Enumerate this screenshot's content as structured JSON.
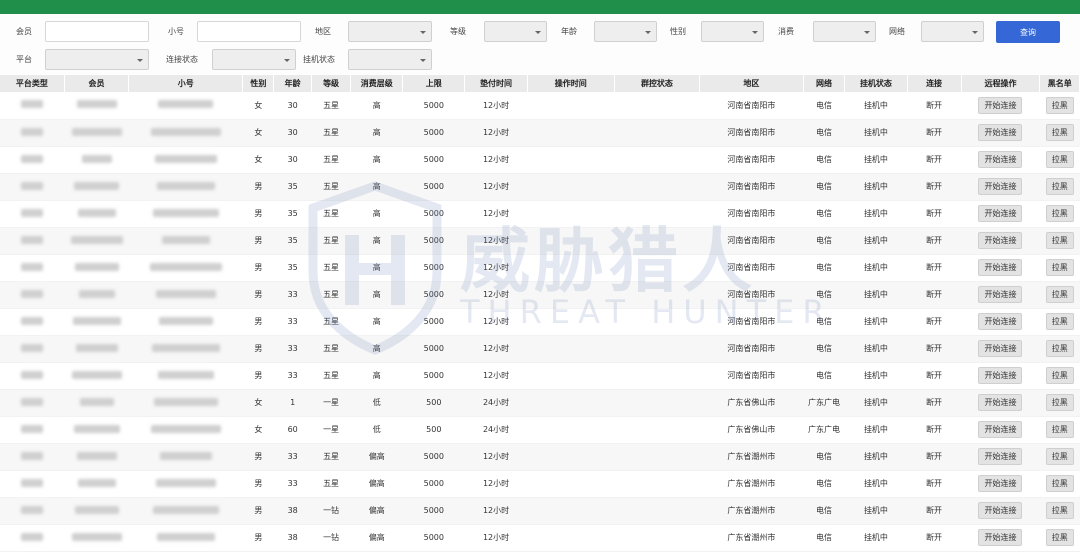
{
  "filters": {
    "member_label": "会员",
    "member_value": "",
    "alt_label": "小号",
    "alt_value": "",
    "region_label": "地区",
    "level_label": "等级",
    "age_label": "年龄",
    "gender_label": "性别",
    "spending_label": "消费",
    "network_label": "网络",
    "platform_label": "平台",
    "connect_status_label": "连接状态",
    "hang_status_label": "挂机状态",
    "search_button": "查询"
  },
  "table": {
    "columns": [
      "平台类型",
      "会员",
      "小号",
      "性别",
      "年龄",
      "等级",
      "消费层级",
      "上限",
      "垫付时间",
      "操作时间",
      "群控状态",
      "地区",
      "网络",
      "挂机状态",
      "连接",
      "远程操作",
      "黑名单"
    ],
    "rows": [
      {
        "gender": "女",
        "age": "30",
        "level": "五星",
        "spend": "高",
        "limit": "5000",
        "pay_time": "12小时",
        "region": "河南省南阳市",
        "network": "电信",
        "hang": "挂机中",
        "conn": "断开",
        "remote": "开始连接",
        "black": "拉黑"
      },
      {
        "gender": "女",
        "age": "30",
        "level": "五星",
        "spend": "高",
        "limit": "5000",
        "pay_time": "12小时",
        "region": "河南省南阳市",
        "network": "电信",
        "hang": "挂机中",
        "conn": "断开",
        "remote": "开始连接",
        "black": "拉黑"
      },
      {
        "gender": "女",
        "age": "30",
        "level": "五星",
        "spend": "高",
        "limit": "5000",
        "pay_time": "12小时",
        "region": "河南省南阳市",
        "network": "电信",
        "hang": "挂机中",
        "conn": "断开",
        "remote": "开始连接",
        "black": "拉黑"
      },
      {
        "gender": "男",
        "age": "35",
        "level": "五星",
        "spend": "高",
        "limit": "5000",
        "pay_time": "12小时",
        "region": "河南省南阳市",
        "network": "电信",
        "hang": "挂机中",
        "conn": "断开",
        "remote": "开始连接",
        "black": "拉黑"
      },
      {
        "gender": "男",
        "age": "35",
        "level": "五星",
        "spend": "高",
        "limit": "5000",
        "pay_time": "12小时",
        "region": "河南省南阳市",
        "network": "电信",
        "hang": "挂机中",
        "conn": "断开",
        "remote": "开始连接",
        "black": "拉黑"
      },
      {
        "gender": "男",
        "age": "35",
        "level": "五星",
        "spend": "高",
        "limit": "5000",
        "pay_time": "12小时",
        "region": "河南省南阳市",
        "network": "电信",
        "hang": "挂机中",
        "conn": "断开",
        "remote": "开始连接",
        "black": "拉黑"
      },
      {
        "gender": "男",
        "age": "35",
        "level": "五星",
        "spend": "高",
        "limit": "5000",
        "pay_time": "12小时",
        "region": "河南省南阳市",
        "network": "电信",
        "hang": "挂机中",
        "conn": "断开",
        "remote": "开始连接",
        "black": "拉黑"
      },
      {
        "gender": "男",
        "age": "33",
        "level": "五星",
        "spend": "高",
        "limit": "5000",
        "pay_time": "12小时",
        "region": "河南省南阳市",
        "network": "电信",
        "hang": "挂机中",
        "conn": "断开",
        "remote": "开始连接",
        "black": "拉黑"
      },
      {
        "gender": "男",
        "age": "33",
        "level": "五星",
        "spend": "高",
        "limit": "5000",
        "pay_time": "12小时",
        "region": "河南省南阳市",
        "network": "电信",
        "hang": "挂机中",
        "conn": "断开",
        "remote": "开始连接",
        "black": "拉黑"
      },
      {
        "gender": "男",
        "age": "33",
        "level": "五星",
        "spend": "高",
        "limit": "5000",
        "pay_time": "12小时",
        "region": "河南省南阳市",
        "network": "电信",
        "hang": "挂机中",
        "conn": "断开",
        "remote": "开始连接",
        "black": "拉黑"
      },
      {
        "gender": "男",
        "age": "33",
        "level": "五星",
        "spend": "高",
        "limit": "5000",
        "pay_time": "12小时",
        "region": "河南省南阳市",
        "network": "电信",
        "hang": "挂机中",
        "conn": "断开",
        "remote": "开始连接",
        "black": "拉黑"
      },
      {
        "gender": "女",
        "age": "1",
        "level": "一星",
        "spend": "低",
        "limit": "500",
        "pay_time": "24小时",
        "region": "广东省佛山市",
        "network": "广东广电",
        "hang": "挂机中",
        "conn": "断开",
        "remote": "开始连接",
        "black": "拉黑"
      },
      {
        "gender": "女",
        "age": "60",
        "level": "一星",
        "spend": "低",
        "limit": "500",
        "pay_time": "24小时",
        "region": "广东省佛山市",
        "network": "广东广电",
        "hang": "挂机中",
        "conn": "断开",
        "remote": "开始连接",
        "black": "拉黑"
      },
      {
        "gender": "男",
        "age": "33",
        "level": "五星",
        "spend": "偏高",
        "limit": "5000",
        "pay_time": "12小时",
        "region": "广东省潮州市",
        "network": "电信",
        "hang": "挂机中",
        "conn": "断开",
        "remote": "开始连接",
        "black": "拉黑"
      },
      {
        "gender": "男",
        "age": "33",
        "level": "五星",
        "spend": "偏高",
        "limit": "5000",
        "pay_time": "12小时",
        "region": "广东省潮州市",
        "network": "电信",
        "hang": "挂机中",
        "conn": "断开",
        "remote": "开始连接",
        "black": "拉黑"
      },
      {
        "gender": "男",
        "age": "38",
        "level": "一钻",
        "spend": "偏高",
        "limit": "5000",
        "pay_time": "12小时",
        "region": "广东省潮州市",
        "network": "电信",
        "hang": "挂机中",
        "conn": "断开",
        "remote": "开始连接",
        "black": "拉黑"
      },
      {
        "gender": "男",
        "age": "38",
        "level": "一钻",
        "spend": "偏高",
        "limit": "5000",
        "pay_time": "12小时",
        "region": "广东省潮州市",
        "network": "电信",
        "hang": "挂机中",
        "conn": "断开",
        "remote": "开始连接",
        "black": "拉黑"
      }
    ]
  },
  "watermark": {
    "cn": "威胁猎人",
    "en": "THREAT HUNTER"
  },
  "colors": {
    "topbar": "#1f8f4a",
    "primary_button": "#3567d6",
    "header_bg": "#eaeaea"
  },
  "icons": {
    "select_caret": "chevron-down-icon",
    "watermark_logo": "shield-h-icon"
  }
}
